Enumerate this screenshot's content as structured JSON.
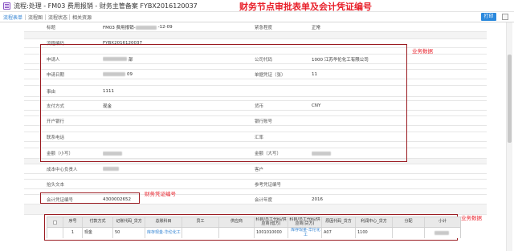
{
  "window": {
    "title": "流程:处理 - FM03 费用报销 - 财务主管备案 FYBX2016120037"
  },
  "tabs": [
    {
      "label": "流程表单",
      "active": true
    },
    {
      "label": "流程图",
      "active": false
    },
    {
      "label": "流程状态",
      "active": false
    },
    {
      "label": "相关资源",
      "active": false
    }
  ],
  "toolbar": {
    "print_label": "打印"
  },
  "annotations": {
    "title": "财务节点审批表单及会计凭证编号",
    "business_data_top": "业务数据",
    "voucher_number": "财务凭证编号",
    "business_data_bottom": "业务数据"
  },
  "form": {
    "row_title": {
      "label": "标题",
      "value": "FM03 费用报销-",
      "value_suffix": "-12-09",
      "label2": "紧急程度",
      "value2": "正常"
    },
    "row_flowno": {
      "label": "流程编码",
      "value": "FYBX2016120037"
    },
    "row_applicant": {
      "label": "申请人",
      "value": "(illegible)",
      "value_suffix": "部",
      "label2": "公司代码",
      "value2": "1000 江苏华伦化工有限公司"
    },
    "row_date": {
      "label": "申请日期",
      "value": "(illegible)",
      "value_suffix": "09",
      "label2": "单据凭证（张）",
      "value2": "11"
    },
    "row_reason": {
      "label": "事由",
      "value": "1111"
    },
    "row_pay": {
      "label": "支付方式",
      "value": "现金",
      "label2": "货币",
      "value2": "CNY"
    },
    "row_bank": {
      "label": "开户银行",
      "value": "",
      "label2": "银行账号",
      "value2": ""
    },
    "row_contact": {
      "label": "联系电话",
      "value": "",
      "label2": "汇率",
      "value2": ""
    },
    "row_amount": {
      "label": "金额（小写）",
      "value": "(illegible)",
      "label2": "金额（大写）",
      "value2": "(illegible)"
    },
    "row_cc": {
      "label": "成本中心负责人",
      "value": "(illegible)",
      "label2": "客户",
      "value2": ""
    },
    "row_text": {
      "label": "抬头文本",
      "value": "",
      "label2": "参考凭证编号",
      "value2": ""
    },
    "row_voucher": {
      "label": "会计凭证编号",
      "value": "4300002652",
      "label2": "会计年度",
      "value2": "2016"
    }
  },
  "grid": {
    "headers": [
      "序号",
      "付款方式",
      "记账代码_贷方",
      "总账科目",
      "员工",
      "供应商",
      "科目/员工代码/供应商(借方)",
      "科目/员工代码/供应商(贷方)",
      "原因代码_贷方",
      "利润中心_贷方",
      "分配",
      "小计"
    ],
    "rows": [
      {
        "index": "1",
        "payment": "现金",
        "posting_code": "50",
        "gl_account": "库存现金-华伦化工",
        "employee": "",
        "supplier": "",
        "debit_account": "1001010000",
        "credit_account": "库存现金-华伦化工",
        "reason_code": "A07",
        "profit_center": "1100",
        "allocation": "",
        "subtotal": "(illegible)"
      }
    ]
  },
  "colors": {
    "accent": "#2c7fd1",
    "annotation": "#e8202a",
    "box_border": "#9b1c22"
  }
}
